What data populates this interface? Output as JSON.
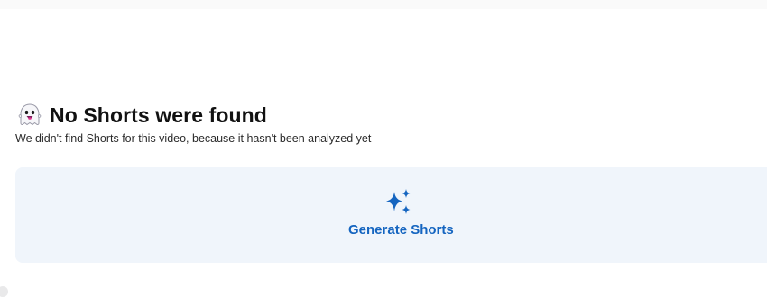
{
  "empty_state": {
    "icon": "ghost-icon",
    "title": "No Shorts were found",
    "description": "We didn't find Shorts for this video, because it hasn't been analyzed yet"
  },
  "generate_card": {
    "icon": "sparkles-icon",
    "label": "Generate Shorts"
  },
  "colors": {
    "accent": "#1565c0",
    "card_background": "#f0f5fb",
    "title_text": "#111111",
    "body_text": "#2b2b2b"
  }
}
